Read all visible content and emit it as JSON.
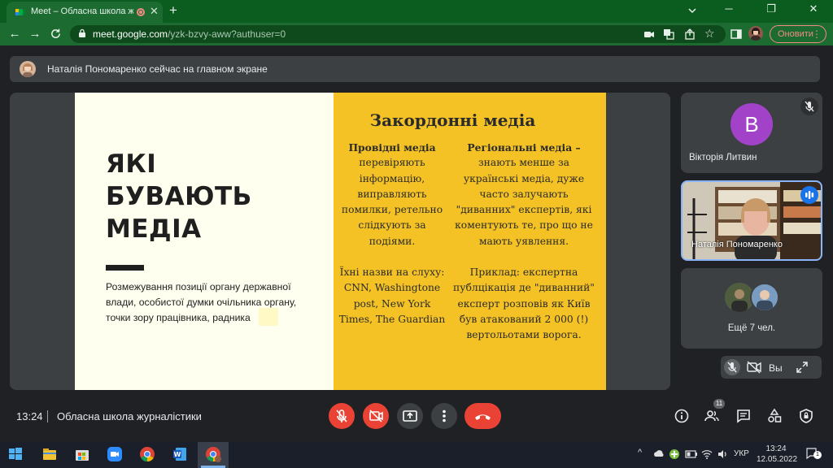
{
  "browser": {
    "tab_title": "Meet – Обласна школа жур",
    "tab_close": "✕",
    "new_tab": "+",
    "window_min": "─",
    "window_restore": "❐",
    "window_close": "✕",
    "url_host": "meet.google.com",
    "url_path": "/yzk-bzvy-aww?authuser=0",
    "sync_label": "Оновити",
    "chrome_accent": "#1c6b31"
  },
  "meet": {
    "banner_text": "Наталія Пономаренко сейчас на главном экране",
    "clock": "13:24",
    "meeting_name": "Обласна школа журналістики",
    "people_count": "11",
    "self_label": "Вы",
    "controls_color_off": "#ea4335"
  },
  "slide": {
    "heading_lines": [
      "ЯКІ",
      "БУВАЮТЬ",
      "МЕДІА"
    ],
    "subtitle": "Розмежування позиції органу державної влади, особистої думки очільника органу, точки зору працівника, радника",
    "right_title": "Закордонні медіа",
    "col1": {
      "heading": "Провідні медіа",
      "p1": "перевіряють інформацію, виправляють помилки, ретельно слідкують за подіями.",
      "p2": "Їхні назви на слуху: CNN, Washingtone post, New York Times, The Guardian"
    },
    "col2": {
      "heading": "Регіональні медіа –",
      "p1": "знають менше за українські медіа, дуже часто залучають \"диванних\" експертів, які коментують те, про що не мають уявлення.",
      "p2": "Приклад: експертна публцікація де \"диванний\" експерт розповів як Київ був атакований 2 000 (!) вертольотами ворога."
    },
    "yellow": "#f4c224"
  },
  "participants": {
    "tile1_initial": "B",
    "tile1_name": "Вікторія Литвин",
    "tile1_color": "#a142c8",
    "tile2_name": "Наталія Пономаренко",
    "more_label": "Ещё 7 чел."
  },
  "taskbar": {
    "language": "УКР",
    "time": "13:24",
    "date": "12.05.2022",
    "tray_chevron": "^",
    "notifications": "1"
  }
}
